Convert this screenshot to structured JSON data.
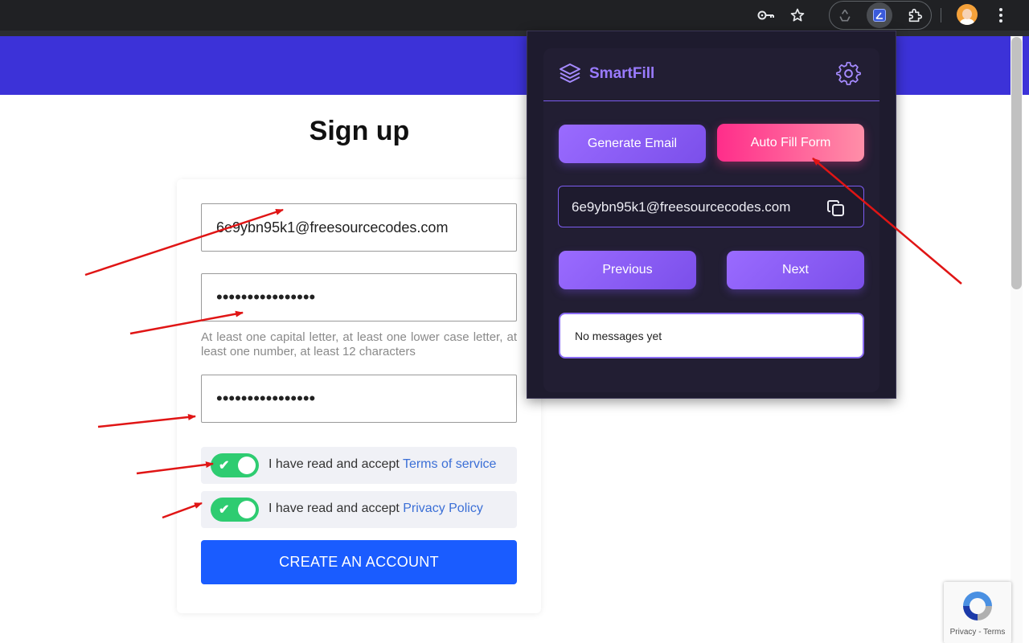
{
  "browser": {
    "toolbar_icons": [
      "key-icon",
      "star-icon",
      "recycle-extension-icon",
      "smartfill-extension-icon",
      "puzzle-extensions-icon",
      "profile-avatar",
      "kebab-menu-icon"
    ]
  },
  "page": {
    "title": "Sign up",
    "email_value": "6e9ybn95k1@freesourcecodes.com",
    "password_value": "••••••••••••••••",
    "password_hint": "At least one capital letter, at least one lower case letter, at least one number, at least 12 characters",
    "confirm_password_value": "••••••••••••••••",
    "terms_prefix": "I have read and accept",
    "terms_link": "Terms of service",
    "privacy_prefix": "I have read and accept",
    "privacy_link": "Privacy Policy",
    "terms_checked": true,
    "privacy_checked": true,
    "create_button": "CREATE AN ACCOUNT",
    "recaptcha_text": "Privacy - Terms"
  },
  "popup": {
    "brand": "SmartFill",
    "generate_email": "Generate Email",
    "auto_fill": "Auto Fill Form",
    "email": "6e9ybn95k1@freesourcecodes.com",
    "previous": "Previous",
    "next": "Next",
    "message": "No messages yet"
  },
  "colors": {
    "banner": "#3c32d8",
    "brand_purple": "#9a7bff",
    "create_button": "#1a5cff",
    "toggle_on": "#2ecc71",
    "arrow_red": "#e01515"
  }
}
